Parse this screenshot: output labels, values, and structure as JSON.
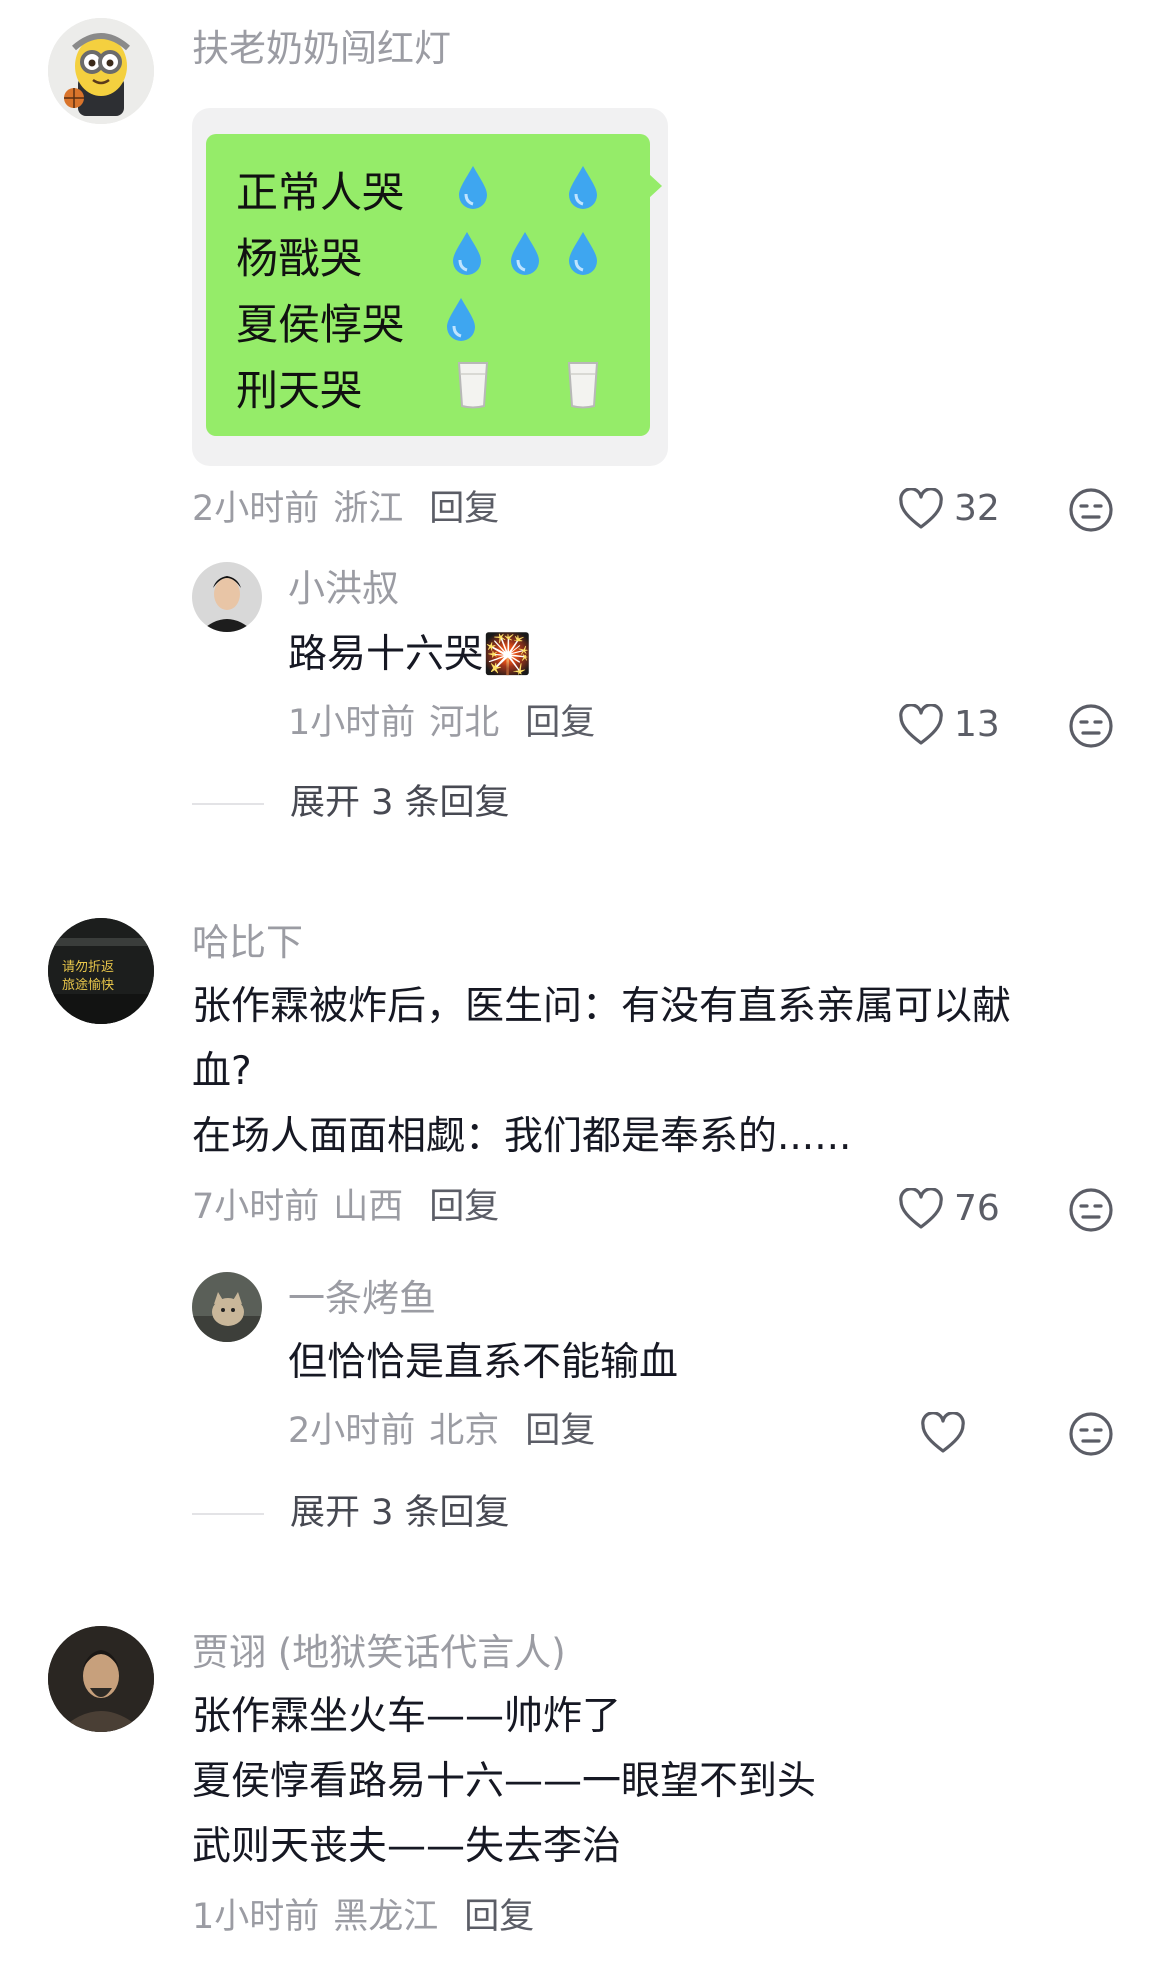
{
  "comments": [
    {
      "username": "扶老奶奶闯红灯",
      "image": {
        "rows": [
          {
            "label": "正常人哭",
            "icons": "drop, drop"
          },
          {
            "label": "杨戬哭",
            "icons": "drop, drop, drop"
          },
          {
            "label": "夏侯惇哭",
            "icons": "drop"
          },
          {
            "label": "刑天哭",
            "icons": "milk, milk"
          }
        ]
      },
      "time": "2小时前",
      "location": "浙江",
      "reply_label": "回复",
      "likes": "32",
      "replies": [
        {
          "username": "小洪叔",
          "content": "路易十六哭🎇",
          "time": "1小时前",
          "location": "河北",
          "reply_label": "回复",
          "likes": "13"
        }
      ],
      "expand_label": "展开 3 条回复"
    },
    {
      "username": "哈比下",
      "avatar_text": [
        "请勿折返",
        "旅途愉快"
      ],
      "content_lines": [
        "张作霖被炸后，医生问：有没有直系亲属可以献",
        "血?",
        "在场人面面相觑：我们都是奉系的......"
      ],
      "time": "7小时前",
      "location": "山西",
      "reply_label": "回复",
      "likes": "76",
      "replies": [
        {
          "username": "一条烤鱼",
          "content": "但恰恰是直系不能输血",
          "time": "2小时前",
          "location": "北京",
          "reply_label": "回复",
          "likes": ""
        }
      ],
      "expand_label": "展开 3 条回复"
    },
    {
      "username": "贾诩 (地狱笑话代言人)",
      "content_lines": [
        "张作霖坐火车——帅炸了",
        "夏侯惇看路易十六——一眼望不到头",
        "武则天丧夫——失去李治"
      ],
      "time": "1小时前",
      "location": "黑龙江",
      "reply_label": "回复"
    }
  ],
  "colors": {
    "username": "#9b9ca3",
    "content": "#161823",
    "bubble": "#95ec69",
    "meta": "#9b9ca3"
  },
  "icons": [
    "heart-icon",
    "dislike-face-icon",
    "water-drop-icon",
    "milk-glass-icon"
  ]
}
